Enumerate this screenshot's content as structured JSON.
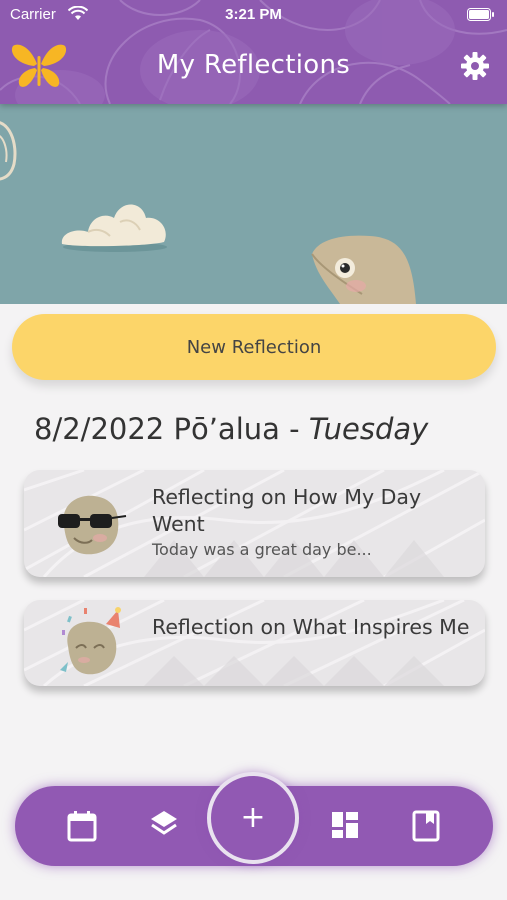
{
  "status": {
    "carrier": "Carrier",
    "time": "3:21 PM"
  },
  "header": {
    "title": "My Reflections",
    "logo_icon": "butterfly-icon",
    "settings_icon": "gear-icon"
  },
  "hero": {
    "description_icon": "fish-and-cloud-illustration"
  },
  "new_reflection": {
    "label": "New Reflection"
  },
  "date": {
    "date": "8/2/2022",
    "hawaiian_day": "Pō’alua",
    "separator": " - ",
    "weekday": "Tuesday"
  },
  "reflections": [
    {
      "title": "Reflecting on How My Day Went",
      "preview": "Today was a great day be...",
      "avatar_icon": "fish-with-sunglasses-icon"
    },
    {
      "title": "Reflection on What Inspires Me",
      "preview": "",
      "avatar_icon": "fish-party-hat-icon"
    }
  ],
  "nav": {
    "items": [
      "calendar-icon",
      "layers-icon",
      "add-icon",
      "dashboard-icon",
      "journal-icon"
    ],
    "add_label": "+"
  },
  "colors": {
    "header": "#8e5bb0",
    "accent_yellow": "#fcd569",
    "nav": "#9159b3",
    "sky": "#7fa5a9"
  }
}
